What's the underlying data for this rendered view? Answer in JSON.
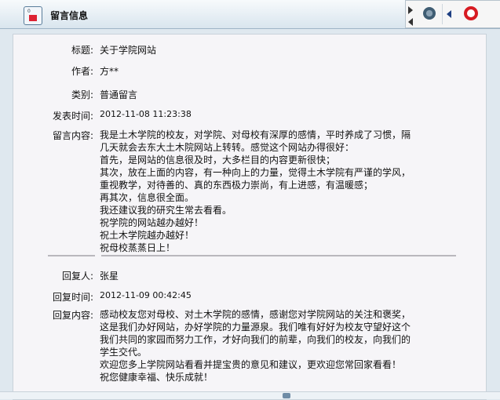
{
  "window": {
    "title": "留言信息",
    "icons": [
      "app-icon",
      "play-icon",
      "gear-icon",
      "back-icon",
      "lifebuoy-icon"
    ]
  },
  "message": {
    "fields": {
      "subject_label": "标题:",
      "subject_value": "关于学院网站",
      "author_label": "作者:",
      "author_value": "方**",
      "category_label": "类别:",
      "category_value": "普通留言",
      "time_label": "发表时间:",
      "time_value": "2012-11-08 11:23:38",
      "content_label": "留言内容:"
    },
    "content_lines": [
      "我是土木学院的校友，对学院、对母校有深厚的感情，平时养成了习惯，隔",
      "几天就会去东大土木院网站上转转。感觉这个网站办得很好：",
      "首先，是网站的信息很及时，大多栏目的内容更新很快；",
      "其次，放在上面的内容，有一种向上的力量，觉得土木学院有严谨的学风，",
      "重视教学，对待善的、真的东西极力崇尚，有上进感，有温暖感；",
      "再其次，信息很全面。",
      "我还建议我的研究生常去看看。",
      "祝学院的网站越办越好！",
      "祝土木学院越办越好！",
      "祝母校蒸蒸日上！"
    ]
  },
  "reply": {
    "fields": {
      "replier_label": "回复人:",
      "replier_value": "张星",
      "time_label": "回复时间:",
      "time_value": "2012-11-09 00:42:45",
      "content_label": "回复内容:"
    },
    "content_lines": [
      "感动校友您对母校、对土木学院的感情，感谢您对学院网站的关注和褒奖，",
      "这是我们办好网站，办好学院的力量源泉。我们唯有好好为校友守望好这个",
      "我们共同的家园而努力工作，才好向我们的前辈，向我们的校友，向我们的",
      "学生交代。",
      "欢迎您多上学院网站看看并提宝贵的意见和建议，更欢迎您常回家看看！",
      "祝您健康幸福、快乐成就！"
    ]
  }
}
